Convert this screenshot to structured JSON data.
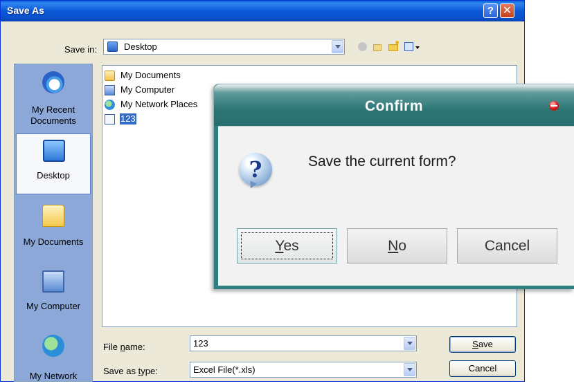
{
  "save_as": {
    "title": "Save As",
    "help_label": "?",
    "close_label": "✕",
    "save_in_label": "Save in:",
    "save_in_value": "Desktop",
    "toolbar": {
      "back_icon": "back-arrow-icon",
      "up_icon": "up-folder-icon",
      "new_folder_icon": "new-folder-icon",
      "views_icon": "views-menu-icon"
    },
    "places": [
      {
        "label_line1": "My Recent",
        "label_line2": "Documents",
        "icon": "recent-documents-icon"
      },
      {
        "label_line1": "Desktop",
        "icon": "desktop-icon",
        "selected": true
      },
      {
        "label_line1": "My Documents",
        "icon": "my-documents-icon"
      },
      {
        "label_line1": "My Computer",
        "icon": "my-computer-icon"
      },
      {
        "label_line1": "My Network",
        "icon": "network-icon"
      }
    ],
    "files": [
      {
        "name": "My Documents",
        "icon": "folder-icon"
      },
      {
        "name": "My Computer",
        "icon": "computer-icon"
      },
      {
        "name": "My Network Places",
        "icon": "network-places-icon"
      },
      {
        "name": "123",
        "icon": "excel-file-icon",
        "selected": true
      }
    ],
    "file_name_label_pre": "File ",
    "file_name_label_ul": "n",
    "file_name_label_post": "ame:",
    "file_name_value": "123",
    "save_type_label_pre": "Save as ",
    "save_type_label_ul": "t",
    "save_type_label_post": "ype:",
    "save_type_value": "Excel File(*.xls)",
    "save_button_ul": "S",
    "save_button_rest": "ave",
    "cancel_button": "Cancel"
  },
  "confirm": {
    "title": "Confirm",
    "message": "Save the current form?",
    "question_glyph": "?",
    "yes_ul": "Y",
    "yes_rest": "es",
    "no_ul": "N",
    "no_rest": "o",
    "cancel": "Cancel"
  },
  "colors": {
    "xp_title_blue": "#0b58d6",
    "places_bar": "#8ca8d9",
    "selection": "#316ac5",
    "confirm_teal": "#2e7676"
  }
}
